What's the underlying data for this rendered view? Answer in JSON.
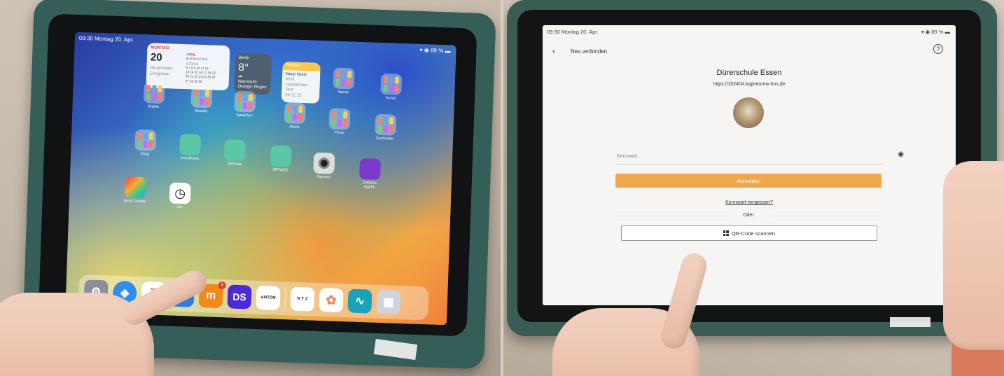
{
  "left": {
    "status": {
      "time": "09:30",
      "date": "Montag 20. Apr.",
      "battery": "89 %"
    },
    "calendar": {
      "weekday": "MONTAG",
      "day": "20",
      "month": "APRIL",
      "note": "Heute keine Ereignisse",
      "grid": [
        "M D M D F S S",
        "  1 2 3 4 5",
        "6 7 8 9 10 11 12",
        "13 14 15 16 17 18 19",
        "20 21 22 23 24 25 26",
        "27 28 29 30"
      ]
    },
    "weather": {
      "city": "Berlin",
      "temp": "8°",
      "line1": "Warnstufe",
      "line2": "Orange: Regen"
    },
    "notes": {
      "header": "Notizen",
      "line1": "Neue Notiz",
      "line2": "Kein zusätzlicher",
      "line3": "Text",
      "date": "20.12.25"
    },
    "apps": [
      {
        "label": "Spiele"
      },
      {
        "label": "Kunst"
      },
      {
        "label": "Mathe"
      },
      {
        "label": "Moodle"
      },
      {
        "label": "Sprachen"
      },
      {
        "label": "Musik"
      },
      {
        "label": "Filme"
      },
      {
        "label": "Sachunter."
      },
      {
        "label": "Zeug"
      },
      {
        "label": "Installieren"
      },
      {
        "label": "ZIP/Teile"
      },
      {
        "label": "ZIP/LOG"
      },
      {
        "label": "Kamera"
      },
      {
        "label": "Deltafox AppFL"
      },
      {
        "label": "Book Creator"
      },
      {
        "label": "Uhr"
      }
    ],
    "dock": {
      "calendar_weekday": "MO",
      "calendar_day": "20",
      "moodle_badge": "1",
      "ds_label": "DS",
      "anton_label": "ANTON",
      "ntz_label": "N T Z"
    }
  },
  "right": {
    "status": {
      "time": "09:30",
      "date": "Montag 20. Apr.",
      "battery": "89 %"
    },
    "nav_title": "Neu verbinden",
    "help": "?",
    "school_name": "Dürerschule Essen",
    "url": "https://102404.logineonrw-lms.de",
    "password_label": "Kennwort",
    "login_button": "Anmelden",
    "forgot_link": "Kennwort vergessen?",
    "or_label": "Oder",
    "qr_button": "QR-Code scannen"
  }
}
